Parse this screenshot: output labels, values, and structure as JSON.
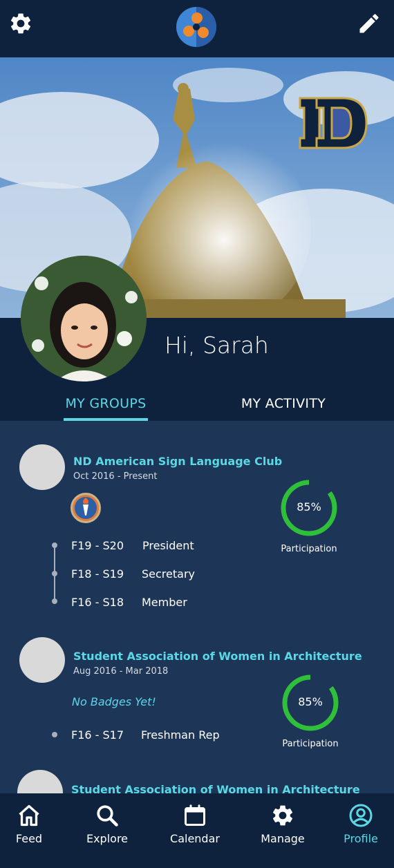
{
  "header": {
    "settings_icon": "gear-icon",
    "edit_icon": "pencil-icon",
    "logo": "app-logo"
  },
  "profile": {
    "greeting": "Hi, Sarah",
    "school_logo_text": "ND"
  },
  "tabs": [
    {
      "label": "MY GROUPS",
      "active": true
    },
    {
      "label": "MY ACTIVITY",
      "active": false
    }
  ],
  "groups": [
    {
      "name": "ND American Sign Language Club",
      "dates": "Oct 2016 - Present",
      "badges": "torch-badge",
      "participation": {
        "value": "85%",
        "label": "Participation",
        "fraction": 0.85
      },
      "roles": [
        {
          "term": "F19 - S20",
          "role": "President"
        },
        {
          "term": "F18 - S19",
          "role": "Secretary"
        },
        {
          "term": "F16 - S18",
          "role": "Member"
        }
      ]
    },
    {
      "name": "Student Association of Women in Architecture",
      "dates": "Aug 2016 - Mar 2018",
      "no_badges": "No Badges Yet!",
      "participation": {
        "value": "85%",
        "label": "Participation",
        "fraction": 0.85
      },
      "roles": [
        {
          "term": "F16 - S17",
          "role": "Freshman Rep"
        }
      ]
    },
    {
      "name": "Student Association of Women in Architecture"
    }
  ],
  "bottom_nav": [
    {
      "label": "Feed",
      "icon": "home-icon"
    },
    {
      "label": "Explore",
      "icon": "search-icon"
    },
    {
      "label": "Calendar",
      "icon": "calendar-icon"
    },
    {
      "label": "Manage",
      "icon": "gear-icon"
    },
    {
      "label": "Profile",
      "icon": "profile-icon",
      "active": true
    }
  ],
  "colors": {
    "accent": "#5ad8e6",
    "navy": "#0f223d",
    "panel": "#1d3557",
    "progress": "#2fbf3a"
  }
}
